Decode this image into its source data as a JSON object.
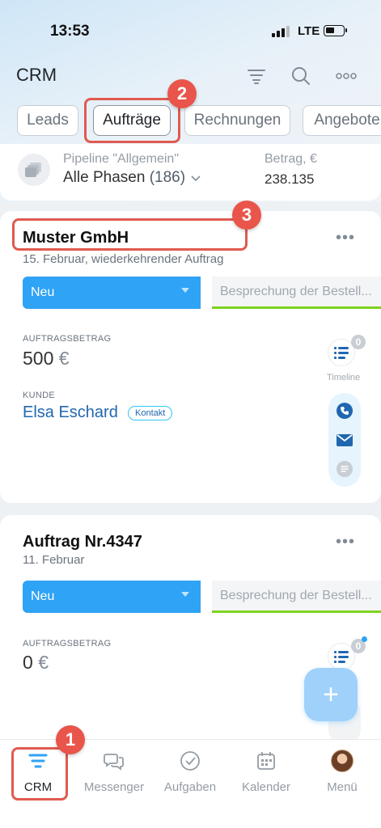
{
  "status_bar": {
    "time": "13:53",
    "network": "LTE"
  },
  "header": {
    "title": "CRM"
  },
  "tabs": [
    "Leads",
    "Aufträge",
    "Rechnungen",
    "Angebote"
  ],
  "pipeline": {
    "label": "Pipeline \"Allgemein\"",
    "value": "Alle Phasen",
    "count": "(186)",
    "sum_label": "Betrag, €",
    "sum_value": "238.135"
  },
  "annotations": [
    "1",
    "2",
    "3"
  ],
  "cards": [
    {
      "title": "Muster GmbH",
      "subtitle": "15. Februar, wiederkehrender Auftrag",
      "stage": "Neu",
      "next_stage": "Besprechung der Bestell...",
      "amount_label": "AUFTRAGSBETRAG",
      "amount": "500",
      "currency": "€",
      "client_label": "KUNDE",
      "client_name": "Elsa Eschard",
      "client_type": "Kontakt",
      "timeline_count": "0",
      "timeline_label": "Timeline"
    },
    {
      "title": "Auftrag Nr.4347",
      "subtitle": "11. Februar",
      "stage": "Neu",
      "next_stage": "Besprechung der Bestell...",
      "amount_label": "AUFTRAGSBETRAG",
      "amount": "0",
      "currency": "€",
      "timeline_count": "0"
    }
  ],
  "nav": [
    {
      "label": "CRM",
      "icon": "crm-filter-icon"
    },
    {
      "label": "Messenger",
      "icon": "chat-icon"
    },
    {
      "label": "Aufgaben",
      "icon": "check-circle-icon"
    },
    {
      "label": "Kalender",
      "icon": "calendar-icon"
    },
    {
      "label": "Menü",
      "icon": "avatar"
    }
  ],
  "colors": {
    "accent": "#2fa3f5",
    "annotation": "#e9554b",
    "link": "#2067b0",
    "progress": "#7ed321"
  }
}
